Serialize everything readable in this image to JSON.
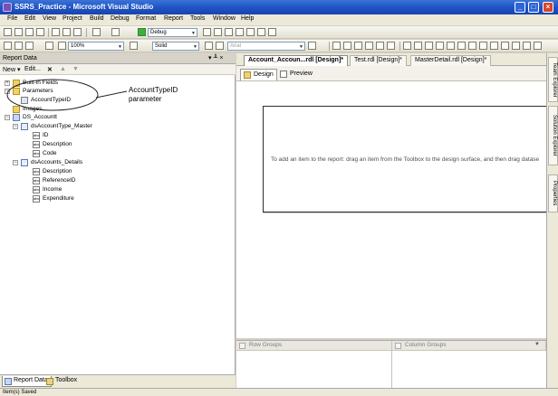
{
  "window": {
    "title": "SSRS_Practice - Microsoft Visual Studio",
    "buttons": [
      "_",
      "□",
      "×"
    ]
  },
  "menu": {
    "items": [
      "File",
      "Edit",
      "View",
      "Project",
      "Build",
      "Debug",
      "Format",
      "Report",
      "Tools",
      "Window",
      "Help"
    ]
  },
  "toolbar": {
    "config_combo": "Debug",
    "zoom_combo": "100%",
    "border_style_combo": "Solid",
    "font_combo": "Arial"
  },
  "report_data_panel": {
    "title": "Report Data",
    "pin": "▾ ╨ ×",
    "new_label": "New ▾",
    "edit_label": "Edit...",
    "tree": {
      "built_in_fields": "Built-in Fields",
      "parameters": "Parameters",
      "account_type_id": "AccountTypeID",
      "images": "Images",
      "data_source": "DS_Accountt",
      "dataset1": {
        "name": "dsAccountType_Master",
        "fields": [
          "ID",
          "Description",
          "Code"
        ]
      },
      "dataset2": {
        "name": "dsAccounts_Details",
        "fields": [
          "Description",
          "ReferenceID",
          "Income",
          "Expenditure"
        ]
      }
    },
    "callout": {
      "line1": "AccountTypeID",
      "line2": "parameter"
    },
    "bottom_tabs": [
      "Report Data",
      "Toolbox"
    ]
  },
  "document_tabs": [
    "Account_Accoun...rdl [Design]*",
    "Test.rdl [Design]*",
    "MasterDetail.rdl [Design]*"
  ],
  "designer": {
    "sub_tabs": [
      "Design",
      "Preview"
    ],
    "empty_message": "To add an item to the report: drag an item from the Toolbox to the design surface, and then drag datase"
  },
  "grouping": {
    "row_groups": "Row Groups",
    "column_groups": "Column Groups"
  },
  "right_strip": [
    "Team Explorer",
    "Solution Explorer",
    "Properties"
  ],
  "status": "Item(s) Saved"
}
